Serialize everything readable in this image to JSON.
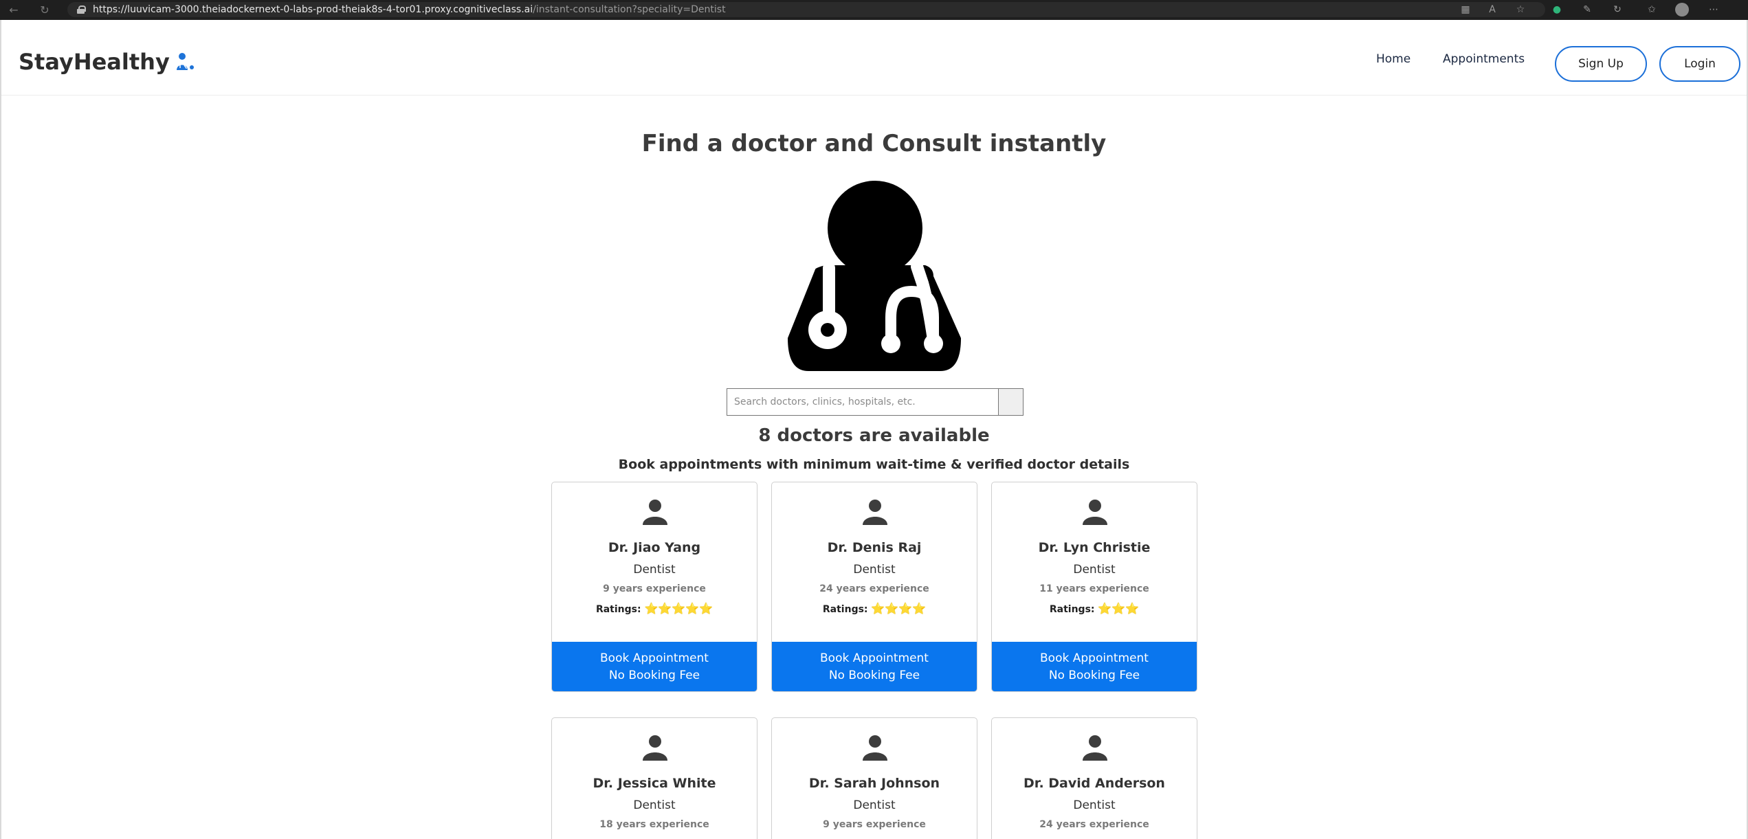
{
  "browser": {
    "url_host": "https://luuvicam-3000.theiadockernext-0-labs-prod-theiak8s-4-tor01.proxy.cognitiveclass.ai",
    "url_path": "/instant-consultation?speciality=Dentist"
  },
  "navbar": {
    "brand": "StayHealthy",
    "home_label": "Home",
    "appointments_label": "Appointments",
    "signup_label": "Sign Up",
    "login_label": "Login"
  },
  "main": {
    "heading": "Find a doctor and Consult instantly",
    "search_placeholder": "Search doctors, clinics, hospitals, etc.",
    "count_text": "8 doctors are available",
    "subheading": "Book appointments with minimum wait-time & verified doctor details"
  },
  "doctors": [
    {
      "name": "Dr. Jiao Yang",
      "speciality": "Dentist",
      "experience": "9 years experience",
      "ratings_label": "Ratings:",
      "rating": 5,
      "stars": "⭐⭐⭐⭐⭐",
      "book_label": "Book Appointment",
      "fee_label": "No Booking Fee"
    },
    {
      "name": "Dr. Denis Raj",
      "speciality": "Dentist",
      "experience": "24 years experience",
      "ratings_label": "Ratings:",
      "rating": 4,
      "stars": "⭐⭐⭐⭐",
      "book_label": "Book Appointment",
      "fee_label": "No Booking Fee"
    },
    {
      "name": "Dr. Lyn Christie",
      "speciality": "Dentist",
      "experience": "11 years experience",
      "ratings_label": "Ratings:",
      "rating": 3,
      "stars": "⭐⭐⭐",
      "book_label": "Book Appointment",
      "fee_label": "No Booking Fee"
    },
    {
      "name": "Dr. Jessica White",
      "speciality": "Dentist",
      "experience": "18 years experience"
    },
    {
      "name": "Dr. Sarah Johnson",
      "speciality": "Dentist",
      "experience": "9 years experience"
    },
    {
      "name": "Dr. David Anderson",
      "speciality": "Dentist",
      "experience": "24 years experience"
    }
  ],
  "colors": {
    "accent": "#0a76ee",
    "pill_border": "#1b6fd8",
    "text_dark": "#333333",
    "browser_bg": "#1f1f1f"
  }
}
